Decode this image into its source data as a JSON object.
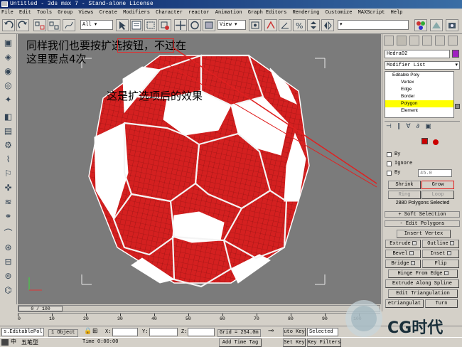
{
  "window": {
    "title": "Untitled - 3ds max 7 - Stand-alone License"
  },
  "menu": [
    "File",
    "Edit",
    "Tools",
    "Group",
    "Views",
    "Create",
    "Modifiers",
    "Character",
    "reactor",
    "Animation",
    "Graph Editors",
    "Rendering",
    "Customize",
    "MAXScript",
    "Help"
  ],
  "toolbar": {
    "selection_filter": "All",
    "ref_coord": "View"
  },
  "viewport": {
    "annotation_line1": "同样我们也要按扩选按钮，不过在",
    "annotation_line2": "这里要点4次",
    "annotation_line3": "这是扩选项后的效果",
    "ball_color": "#d42020",
    "background": "#7b7b7b"
  },
  "command_panel": {
    "object_name": "Hedra02",
    "object_color": "#a020c0",
    "modifier_list": "Modifier List",
    "stack": [
      "Editable Poly",
      "Vertex",
      "Edge",
      "Border",
      "Polygon",
      "Element"
    ],
    "stack_selected": "Polygon",
    "by_label": "By",
    "ignore_label": "Ignore",
    "angle_label": "By",
    "angle_value": "45.0",
    "shrink": "Shrink",
    "grow": "Grow",
    "ring": "Ring",
    "loop": "Loop",
    "selected_info": "2880 Polygons Selected",
    "soft_selection": "Soft Selection",
    "edit_polygons": "Edit Polygons",
    "buttons": [
      "Insert Vertex",
      "Extrude",
      "Outline",
      "Bevel",
      "Inset",
      "Bridge",
      "Flip",
      "Hinge From Edge",
      "Extrude Along Spline",
      "Edit Triangulation",
      "etriangulat",
      "Turn"
    ]
  },
  "timeline": {
    "frame": "0 / 100",
    "ticks": [
      "0",
      "10",
      "20",
      "30",
      "40",
      "50",
      "60",
      "70",
      "80",
      "90",
      "100"
    ]
  },
  "status": {
    "script_field": "s.EditablePol",
    "objects": "1 Object",
    "x_label": "X:",
    "y_label": "Y:",
    "z_label": "Z:",
    "grid": "Grid = 254.0m",
    "auto_key": "uto Key",
    "selected": "Selected",
    "set_key": "Set Key",
    "key_filters": "Key Filters...",
    "time": "Time  0:00:00",
    "add_time_tag": "Add Time Tag",
    "ime": "五笔型"
  },
  "brand": {
    "logo_text": "CG时代"
  }
}
